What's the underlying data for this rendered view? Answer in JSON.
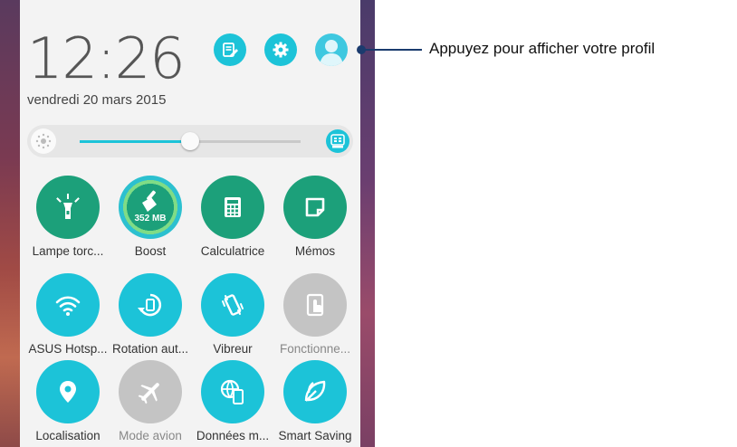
{
  "status": {
    "time": "12:26",
    "date": "vendredi 20 mars 2015"
  },
  "callout": {
    "text": "Appuyez pour afficher votre profil"
  },
  "brightness": {
    "level": 0.5,
    "auto_icon": "auto-brightness-icon"
  },
  "colors": {
    "accent": "#1cc3d8",
    "green": "#1ca07a",
    "disabled": "#c4c4c4"
  },
  "tiles": [
    {
      "label": "Lampe torc...",
      "icon": "flashlight-icon",
      "color": "green",
      "state": "on"
    },
    {
      "label": "Boost",
      "icon": "boost-broom-icon",
      "color": "green",
      "state": "on",
      "value": "352 MB"
    },
    {
      "label": "Calculatrice",
      "icon": "calculator-icon",
      "color": "green",
      "state": "on"
    },
    {
      "label": "Mémos",
      "icon": "memo-icon",
      "color": "green",
      "state": "on"
    },
    {
      "label": "ASUS Hotsp...",
      "icon": "wifi-icon",
      "color": "cyan",
      "state": "on"
    },
    {
      "label": "Rotation aut...",
      "icon": "auto-rotate-icon",
      "color": "cyan",
      "state": "on"
    },
    {
      "label": "Vibreur",
      "icon": "vibrate-icon",
      "color": "cyan",
      "state": "on"
    },
    {
      "label": "Fonctionne...",
      "icon": "touch-gesture-icon",
      "color": "grey",
      "state": "off"
    },
    {
      "label": "Localisation",
      "icon": "location-icon",
      "color": "cyan",
      "state": "on"
    },
    {
      "label": "Mode avion",
      "icon": "airplane-icon",
      "color": "grey",
      "state": "off"
    },
    {
      "label": "Données m...",
      "icon": "mobile-data-icon",
      "color": "cyan",
      "state": "on"
    },
    {
      "label": "Smart Saving",
      "icon": "leaf-icon",
      "color": "cyan",
      "state": "on"
    }
  ]
}
